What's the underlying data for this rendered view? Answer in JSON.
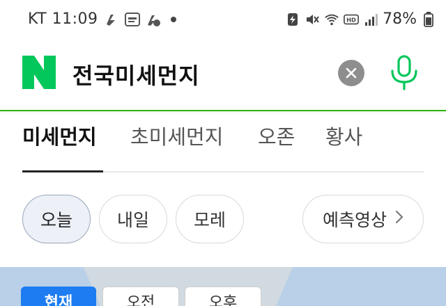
{
  "status_bar": {
    "carrier_time": "KT 11:09",
    "battery_percent": "78%"
  },
  "search": {
    "query": "전국미세먼지",
    "accent_color": "#2db400"
  },
  "tabs": [
    {
      "label": "미세먼지",
      "active": true
    },
    {
      "label": "초미세먼지",
      "active": false
    },
    {
      "label": "오존",
      "active": false
    },
    {
      "label": "황사",
      "active": false
    }
  ],
  "chips": [
    {
      "label": "오늘",
      "selected": true
    },
    {
      "label": "내일",
      "selected": false
    },
    {
      "label": "모레",
      "selected": false
    },
    {
      "label": "예측영상",
      "selected": false
    }
  ],
  "map_tabs": [
    {
      "label": "현재",
      "active": true
    },
    {
      "label": "오전",
      "active": false
    },
    {
      "label": "오후",
      "active": false
    }
  ]
}
